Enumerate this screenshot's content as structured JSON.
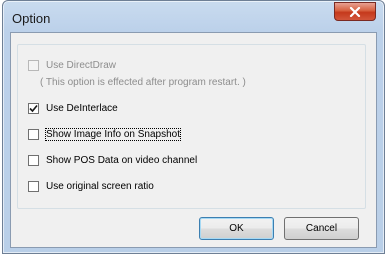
{
  "window": {
    "title": "Option"
  },
  "options": {
    "direct_draw": {
      "label": "Use DirectDraw",
      "checked": false,
      "enabled": false,
      "hint": "( This option is effected after program restart. )"
    },
    "deinterlace": {
      "label": "Use DeInterlace",
      "checked": true,
      "enabled": true
    },
    "image_info": {
      "label": "Show Image Info on Snapshot",
      "checked": false,
      "enabled": true
    },
    "pos_data": {
      "label": "Show POS Data on video channel",
      "checked": false,
      "enabled": true
    },
    "screen_ratio": {
      "label": "Use original screen ratio",
      "checked": false,
      "enabled": true
    }
  },
  "buttons": {
    "ok": "OK",
    "cancel": "Cancel"
  },
  "colors": {
    "frame": "#bcd1ea",
    "close_button": "#c5391c",
    "client": "#f0f0f0"
  },
  "icons": {
    "close": "close-icon",
    "check": "checkmark-icon"
  }
}
